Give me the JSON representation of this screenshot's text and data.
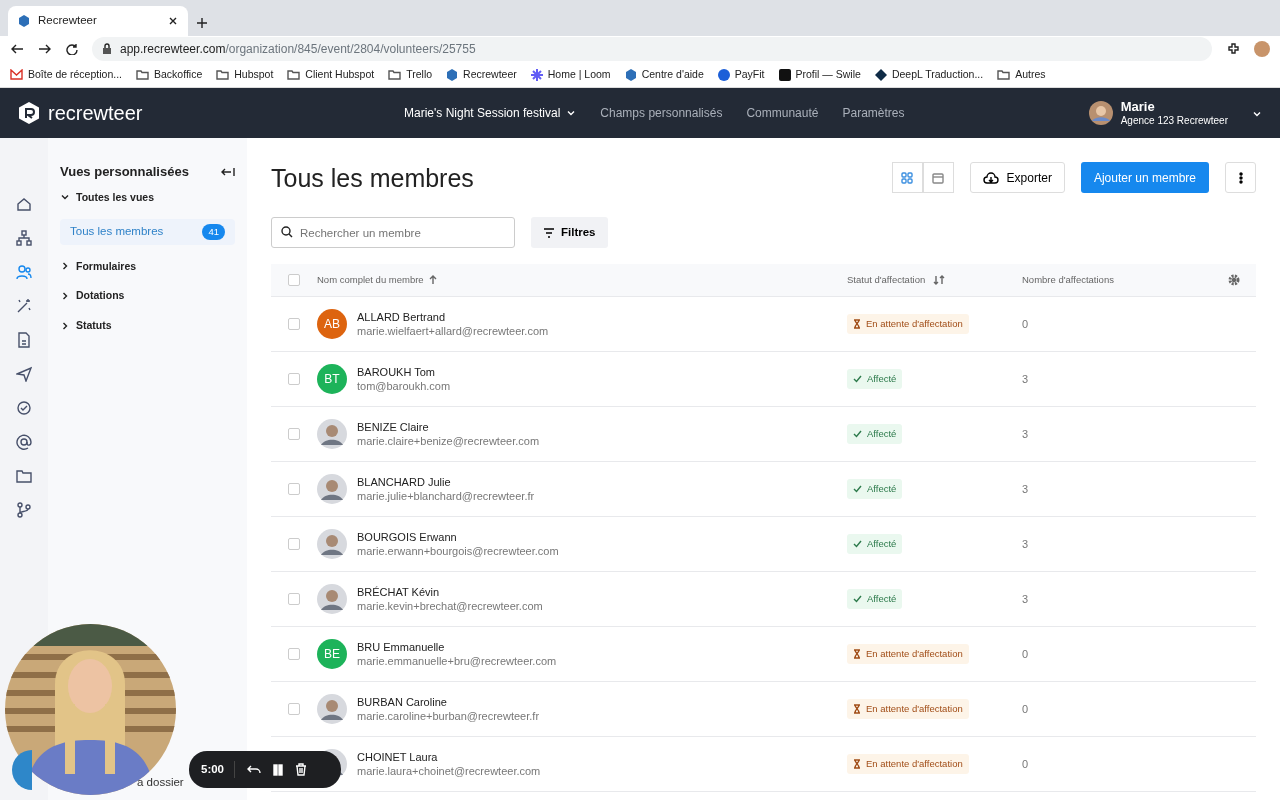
{
  "browser": {
    "tabs": [
      {
        "title": "Recrewteer",
        "selected": true
      }
    ],
    "url_host": "app.recrewteer.com",
    "url_path": "/organization/845/event/2804/volunteers/25755",
    "bookmarks": [
      {
        "kind": "gmail",
        "label": "Boîte de réception..."
      },
      {
        "kind": "folder",
        "label": "Backoffice"
      },
      {
        "kind": "folder",
        "label": "Hubspot"
      },
      {
        "kind": "folder",
        "label": "Client Hubspot"
      },
      {
        "kind": "folder",
        "label": "Trello"
      },
      {
        "kind": "hex",
        "label": "Recrewteer"
      },
      {
        "kind": "star",
        "label": "Home | Loom"
      },
      {
        "kind": "hex",
        "label": "Centre d'aide"
      },
      {
        "kind": "coin",
        "label": "PayFit"
      },
      {
        "kind": "square",
        "label": "Profil — Swile"
      },
      {
        "kind": "diamond",
        "label": "DeepL Traduction..."
      },
      {
        "kind": "folder",
        "label": "Autres"
      }
    ]
  },
  "navbar": {
    "brand": "recrewteer",
    "event": "Marie's Night Session festival",
    "links": [
      "Champs personnalisés",
      "Communauté",
      "Paramètres"
    ],
    "user": {
      "name": "Marie",
      "org": "Agence 123 Recrewteer"
    }
  },
  "rail": [
    {
      "selected": false
    },
    {
      "selected": false
    },
    {
      "selected": true
    },
    {
      "selected": false
    },
    {
      "selected": false
    },
    {
      "selected": false
    },
    {
      "selected": false
    },
    {
      "selected": false
    },
    {
      "selected": false
    },
    {
      "selected": false
    }
  ],
  "sidebar": {
    "title": "Vues personnalisées",
    "groups": [
      {
        "label": "Toutes les vues",
        "expanded": true,
        "items": [
          {
            "label": "Tous les membres",
            "count": "41",
            "selected": true
          }
        ]
      },
      {
        "label": "Formulaires",
        "expanded": false
      },
      {
        "label": "Dotations",
        "expanded": false
      },
      {
        "label": "Statuts",
        "expanded": false
      }
    ],
    "footer": "a dossier"
  },
  "page": {
    "title": "Tous les membres",
    "views": [
      {
        "selected": true
      },
      {
        "selected": false
      }
    ],
    "export": "Exporter",
    "add": "Ajouter un membre",
    "search_placeholder": "Rechercher un membre",
    "filters": "Filtres"
  },
  "table": {
    "select_all_checked": false,
    "columns": [
      "Nom complet du membre",
      "Statut d'affectation",
      "Nombre d'affectations"
    ],
    "rows": [
      {
        "kind": "initials",
        "initials": "AB",
        "color": "#dd640f",
        "name": "ALLARD Bertrand",
        "email": "marie.wielfaert+allard@recrewteer.com",
        "status": {
          "kind": "pending",
          "label": "En attente d'affectation"
        },
        "count": "0",
        "checked": false
      },
      {
        "kind": "initials",
        "initials": "BT",
        "color": "#1db35a",
        "name": "BAROUKH Tom",
        "email": "tom@baroukh.com",
        "status": {
          "kind": "assigned",
          "label": "Affecté"
        },
        "count": "3",
        "checked": false
      },
      {
        "name": "BENIZE Claire",
        "email": "marie.claire+benize@recrewteer.com",
        "status": {
          "kind": "assigned",
          "label": "Affecté"
        },
        "count": "3",
        "checked": false
      },
      {
        "name": "BLANCHARD Julie",
        "email": "marie.julie+blanchard@recrewteer.fr",
        "status": {
          "kind": "assigned",
          "label": "Affecté"
        },
        "count": "3",
        "checked": false
      },
      {
        "name": "BOURGOIS Erwann",
        "email": "marie.erwann+bourgois@recrewteer.com",
        "status": {
          "kind": "assigned",
          "label": "Affecté"
        },
        "count": "3",
        "checked": false
      },
      {
        "name": "BRÉCHAT Kévin",
        "email": "marie.kevin+brechat@recrewteer.com",
        "status": {
          "kind": "assigned",
          "label": "Affecté"
        },
        "count": "3",
        "checked": false
      },
      {
        "kind": "initials",
        "initials": "BE",
        "color": "#1db35a",
        "name": "BRU Emmanuelle",
        "email": "marie.emmanuelle+bru@recrewteer.com",
        "status": {
          "kind": "pending",
          "label": "En attente d'affectation"
        },
        "count": "0",
        "checked": false
      },
      {
        "name": "BURBAN Caroline",
        "email": "marie.caroline+burban@recrewteer.fr",
        "status": {
          "kind": "pending",
          "label": "En attente d'affectation"
        },
        "count": "0",
        "checked": false
      },
      {
        "name": "CHOINET Laura",
        "email": "marie.laura+choinet@recrewteer.com",
        "status": {
          "kind": "pending",
          "label": "En attente d'affectation"
        },
        "count": "0"
      }
    ]
  },
  "recorder": {
    "time": "5:00"
  }
}
